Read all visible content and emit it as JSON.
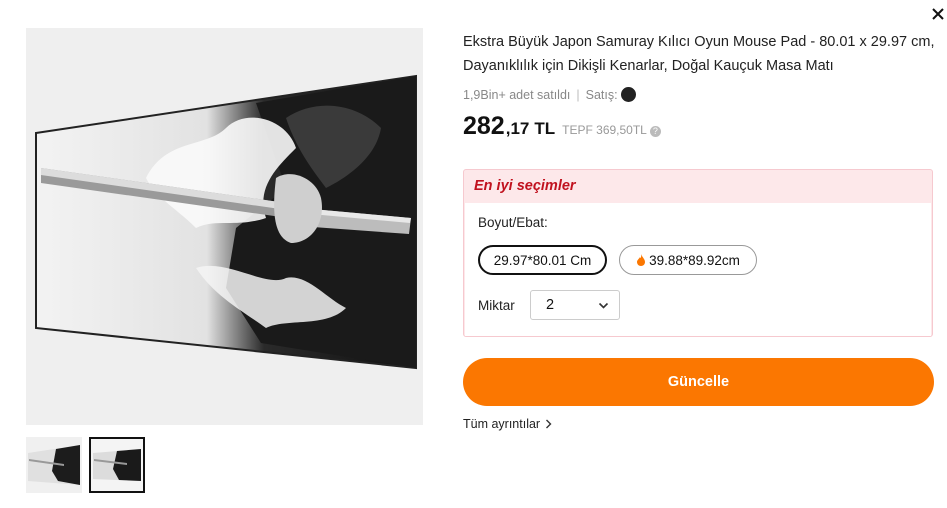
{
  "product": {
    "title": "Ekstra Büyük Japon Samuray Kılıcı Oyun Mouse Pad - 80.01 x 29.97 cm, Dayanıklılık için Dikişli Kenarlar, Doğal Kauçuk Masa Matı",
    "sold_count": "1,9Bin+ adet satıldı",
    "seller_label": "Satış:",
    "price_integer": "282",
    "price_decimal": ",17",
    "currency": "TL",
    "old_price": "TEPF 369,50TL"
  },
  "best_choice": {
    "title": "En iyi seçimler",
    "size_label": "Boyut/Ebat:",
    "size_options": [
      {
        "label": "29.97*80.01 Cm",
        "selected": true
      },
      {
        "label": "39.88*89.92cm",
        "selected": false,
        "icon": "fire-icon"
      }
    ],
    "quantity_label": "Miktar",
    "quantity_value": "2"
  },
  "actions": {
    "update_label": "Güncelle",
    "details_label": "Tüm ayrıntılar"
  },
  "colors": {
    "accent": "#fb7701",
    "best_title": "#c1121f",
    "best_bg": "#fde8ea"
  },
  "gallery": {
    "image_count": 2,
    "active_index": 1
  }
}
